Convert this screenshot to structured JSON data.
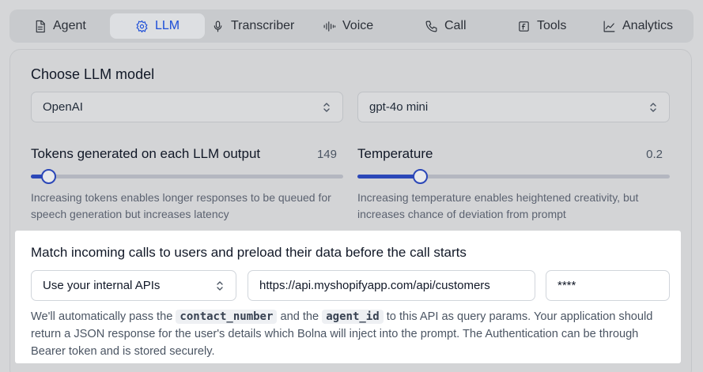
{
  "tabs": [
    {
      "label": "Agent",
      "icon": "document-icon",
      "active": false
    },
    {
      "label": "LLM",
      "icon": "gear-icon",
      "active": true
    },
    {
      "label": "Transcriber",
      "icon": "microphone-icon",
      "active": false
    },
    {
      "label": "Voice",
      "icon": "waveform-icon",
      "active": false
    },
    {
      "label": "Call",
      "icon": "phone-icon",
      "active": false
    },
    {
      "label": "Tools",
      "icon": "function-icon",
      "active": false
    },
    {
      "label": "Analytics",
      "icon": "chart-icon",
      "active": false
    }
  ],
  "llm": {
    "title": "Choose LLM model",
    "provider": "OpenAI",
    "model": "gpt-4o mini"
  },
  "tokens": {
    "label": "Tokens generated on each LLM output",
    "value": "149",
    "fraction": 0.055,
    "helper": "Increasing tokens enables longer responses to be queued for speech generation but increases latency"
  },
  "temperature": {
    "label": "Temperature",
    "value": "0.2",
    "fraction": 0.2,
    "helper": "Increasing temperature enables heightened creativity, but increases chance of deviation from prompt"
  },
  "preload": {
    "title": "Match incoming calls to users and preload their data before the call starts",
    "source": "Use your internal APIs",
    "url": "https://api.myshopifyapp.com/api/customers",
    "token": "****",
    "desc_1": "We'll automatically pass the ",
    "code_1": "contact_number",
    "desc_2": " and the ",
    "code_2": "agent_id",
    "desc_3": " to this API as query params. Your application should return a JSON response for the user's details which Bolna will inject into the prompt. The Authentication can be through Bearer token and is stored securely."
  },
  "colors": {
    "accent": "#1d4ed8",
    "slider": "#2b47b8"
  }
}
